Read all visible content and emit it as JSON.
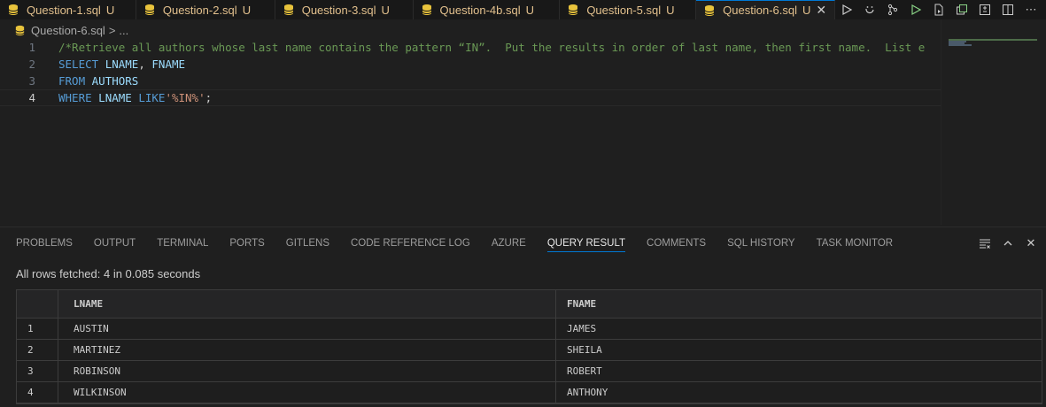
{
  "tabs": [
    {
      "label": "Question-1.sql",
      "status": "U"
    },
    {
      "label": "Question-2.sql",
      "status": "U"
    },
    {
      "label": "Question-3.sql",
      "status": "U"
    },
    {
      "label": "Question-4b.sql",
      "status": "U"
    },
    {
      "label": "Question-5.sql",
      "status": "U"
    },
    {
      "label": "Question-6.sql",
      "status": "U",
      "active": true
    }
  ],
  "breadcrumb": {
    "file": "Question-6.sql",
    "sep": ">",
    "more": "..."
  },
  "editor": {
    "line_numbers": [
      "1",
      "2",
      "3",
      "4"
    ],
    "line1_comment": "/*Retrieve all authors whose last name contains the pattern “IN”.  Put the results in order of last name, then first name.  List e",
    "line2": {
      "kw": "SELECT",
      "col1": "LNAME",
      "comma": ",",
      "col2": "FNAME"
    },
    "line3": {
      "kw": "FROM",
      "table": "AUTHORS"
    },
    "line4": {
      "kw": "WHERE",
      "col": "LNAME",
      "op": "LIKE",
      "str": "'%IN%'",
      "end": ";"
    }
  },
  "panel": {
    "tabs": [
      "PROBLEMS",
      "OUTPUT",
      "TERMINAL",
      "PORTS",
      "GITLENS",
      "CODE REFERENCE LOG",
      "AZURE",
      "QUERY RESULT",
      "COMMENTS",
      "SQL HISTORY",
      "TASK MONITOR"
    ],
    "active_tab": "QUERY RESULT",
    "status": "All rows fetched: 4 in 0.085 seconds"
  },
  "results": {
    "columns": [
      "LNAME",
      "FNAME"
    ],
    "rows": [
      {
        "idx": "1",
        "LNAME": "AUSTIN",
        "FNAME": "JAMES"
      },
      {
        "idx": "2",
        "LNAME": "MARTINEZ",
        "FNAME": "SHEILA"
      },
      {
        "idx": "3",
        "LNAME": "ROBINSON",
        "FNAME": "ROBERT"
      },
      {
        "idx": "4",
        "LNAME": "WILKINSON",
        "FNAME": "ANTHONY"
      }
    ]
  },
  "icons": {
    "tab_file": "database-icon",
    "toolbar": [
      "run-icon",
      "refresh-icon",
      "source-control-icon",
      "run-alt-icon",
      "file-run-icon",
      "open-changes-icon",
      "compare-icon",
      "split-editor-icon",
      "more-icon"
    ],
    "panel": [
      "clear-icon",
      "maximize-icon",
      "close-icon"
    ]
  },
  "colors": {
    "accent": "#0078d4",
    "tab_text": "#e2c08d",
    "keyword": "#569cd6",
    "identifier": "#9cdcfe",
    "comment": "#6a9955",
    "string": "#ce9178"
  }
}
